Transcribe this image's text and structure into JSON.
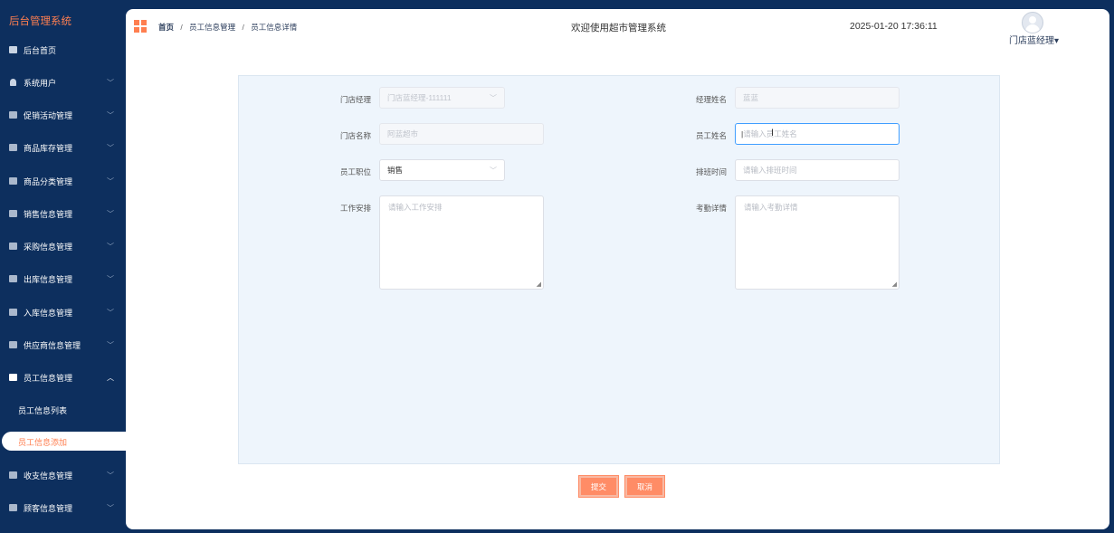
{
  "sidebar": {
    "brand": "后台管理系统",
    "items": [
      {
        "label": "后台首页",
        "icon": "monitor-icon",
        "has_chevron": false
      },
      {
        "label": "系统用户",
        "icon": "user-icon",
        "has_chevron": true
      },
      {
        "label": "促销活动管理",
        "icon": "check-square-icon",
        "has_chevron": true
      },
      {
        "label": "商品库存管理",
        "icon": "check-square-icon",
        "has_chevron": true
      },
      {
        "label": "商品分类管理",
        "icon": "check-square-icon",
        "has_chevron": true
      },
      {
        "label": "销售信息管理",
        "icon": "check-square-icon",
        "has_chevron": true
      },
      {
        "label": "采购信息管理",
        "icon": "check-square-icon",
        "has_chevron": true
      },
      {
        "label": "出库信息管理",
        "icon": "check-square-icon",
        "has_chevron": true
      },
      {
        "label": "入库信息管理",
        "icon": "check-square-icon",
        "has_chevron": true
      },
      {
        "label": "供应商信息管理",
        "icon": "check-square-icon",
        "has_chevron": true
      },
      {
        "label": "员工信息管理",
        "icon": "check-square-icon",
        "has_chevron": true,
        "expanded": true
      },
      {
        "label": "收支信息管理",
        "icon": "check-square-icon",
        "has_chevron": true
      },
      {
        "label": "顾客信息管理",
        "icon": "check-square-icon",
        "has_chevron": true
      }
    ],
    "sub_items": [
      "员工信息列表",
      "员工信息添加"
    ],
    "active_sub": "员工信息添加"
  },
  "header": {
    "breadcrumb": [
      "首页",
      "员工信息管理",
      "员工信息详情"
    ],
    "welcome": "欢迎使用超市管理系统",
    "datetime": "2025-01-20 17:36:11",
    "user": "门店蓝经理",
    "user_caret": "▾"
  },
  "form": {
    "store_manager": {
      "label": "门店经理",
      "value": "门店蓝经理-111111",
      "disabled": true
    },
    "manager_name": {
      "label": "经理姓名",
      "value": "蓝蓝",
      "disabled": true
    },
    "store_name": {
      "label": "门店名称",
      "value": "阿蓝超市",
      "disabled": true
    },
    "employee_name": {
      "label": "员工姓名",
      "placeholder": "请输入员工姓名",
      "focused": true
    },
    "position": {
      "label": "员工职位",
      "value": "销售"
    },
    "schedule_time": {
      "label": "排班时间",
      "placeholder": "请输入排班时间"
    },
    "work_arrangement": {
      "label": "工作安排",
      "placeholder": "请输入工作安排"
    },
    "attendance": {
      "label": "考勤详情",
      "placeholder": "请输入考勤详情"
    }
  },
  "buttons": {
    "submit": "提交",
    "cancel": "取消"
  },
  "colors": {
    "sidebar_bg": "#0d2f5e",
    "accent": "#ff7f50",
    "form_bg": "#eef5fc",
    "button": "#ff8c66"
  }
}
